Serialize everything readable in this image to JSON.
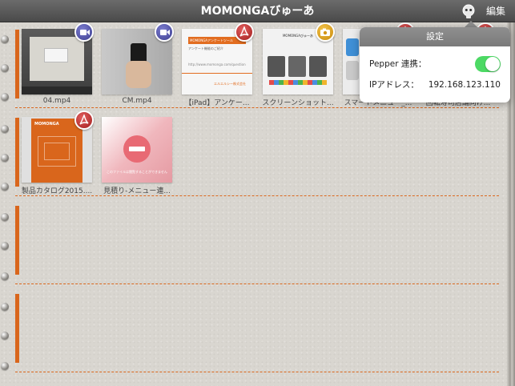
{
  "navbar": {
    "title": "MOMONGAびゅーあ",
    "edit_label": "編集",
    "pepper_icon": "pepper-robot-icon"
  },
  "colors": {
    "accent": "#d9661c",
    "toggle_on": "#4cd964",
    "video_badge": "#4b4ca5",
    "pdf_badge": "#c02b2b",
    "image_badge": "#e0a31f"
  },
  "files": [
    {
      "name": "04.mp4",
      "type": "video",
      "badge_icon": "video-icon"
    },
    {
      "name": "CM.mp4",
      "type": "video",
      "badge_icon": "video-icon"
    },
    {
      "name": "【iPad】アンケー...",
      "type": "pdf",
      "badge_icon": "pdf-icon",
      "thumb_title": "MOMONGAアンケートツール",
      "thumb_subtitle": "アンケート機能のご紹介",
      "thumb_url": "http://www.momonga.com/questionnaire",
      "thumb_footer": "エルエルシー株式会社"
    },
    {
      "name": "スクリーンショット...",
      "type": "image",
      "badge_icon": "camera-icon",
      "thumb_caption": "MOMONGAびゅーあ"
    },
    {
      "name": "スマートメニュー_...",
      "type": "pdf",
      "badge_icon": "pdf-icon"
    },
    {
      "name": "回転寿司店舗向け...",
      "type": "pdf",
      "badge_icon": "pdf-icon"
    },
    {
      "name": "製品カタログ2015....",
      "type": "pdf",
      "badge_icon": "pdf-icon",
      "thumb_brand": "MOMONGA"
    },
    {
      "name": "見積り-メニュー連...",
      "type": "unavailable",
      "badge_icon": "no-entry-icon",
      "thumb_caption": "このファイルは閲覧することができません"
    }
  ],
  "settings_popover": {
    "title": "設定",
    "pepper_label": "Pepper 連携：",
    "pepper_enabled": true,
    "ip_label": "IPアドレス：",
    "ip_value": "192.168.123.110"
  }
}
